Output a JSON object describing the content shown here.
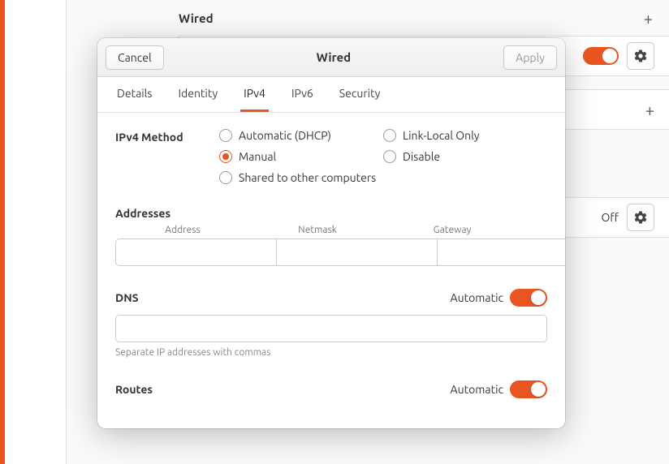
{
  "background": {
    "section_title": "Wired",
    "off_label": "Off"
  },
  "dialog": {
    "cancel": "Cancel",
    "apply": "Apply",
    "title": "Wired",
    "tabs": {
      "details": "Details",
      "identity": "Identity",
      "ipv4": "IPv4",
      "ipv6": "IPv6",
      "security": "Security"
    },
    "ipv4": {
      "method_label": "IPv4 Method",
      "options": {
        "auto": "Automatic (DHCP)",
        "linklocal": "Link-Local Only",
        "manual": "Manual",
        "disable": "Disable",
        "shared": "Shared to other computers"
      },
      "selected": "manual",
      "addresses": {
        "title": "Addresses",
        "headers": {
          "address": "Address",
          "netmask": "Netmask",
          "gateway": "Gateway"
        },
        "row": {
          "address": "",
          "netmask": "",
          "gateway": ""
        }
      },
      "dns": {
        "title": "DNS",
        "automatic_label": "Automatic",
        "automatic": true,
        "value": "",
        "hint": "Separate IP addresses with commas"
      },
      "routes": {
        "title": "Routes",
        "automatic_label": "Automatic",
        "automatic": true
      }
    }
  }
}
